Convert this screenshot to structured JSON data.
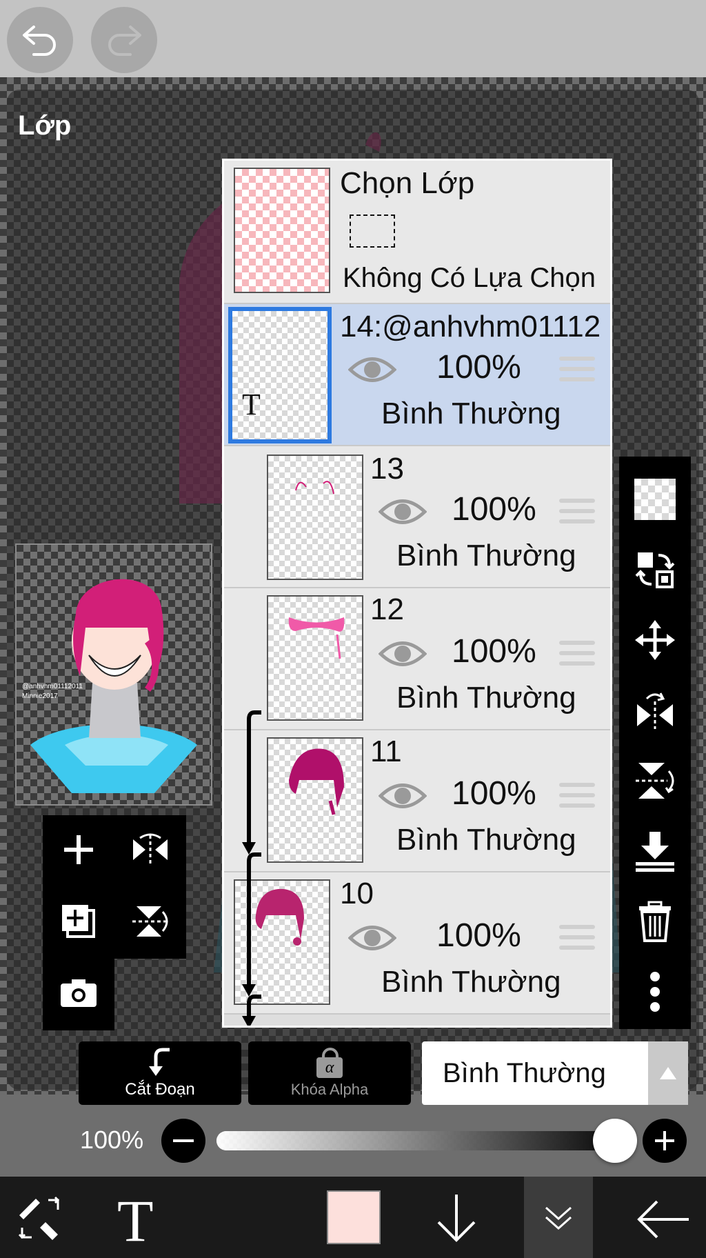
{
  "window": {
    "title": "Lớp"
  },
  "selection": {
    "title": "Chọn Lớp",
    "status": "Không Có Lựa Chọn"
  },
  "layers": [
    {
      "name": "14:@anhvhm01112",
      "opacity": "100%",
      "blend": "Bình Thường",
      "selected": true,
      "text_layer_glyph": "T"
    },
    {
      "name": "13",
      "opacity": "100%",
      "blend": "Bình Thường"
    },
    {
      "name": "12",
      "opacity": "100%",
      "blend": "Bình Thường"
    },
    {
      "name": "11",
      "opacity": "100%",
      "blend": "Bình Thường"
    },
    {
      "name": "10",
      "opacity": "100%",
      "blend": "Bình Thường"
    }
  ],
  "preview": {
    "watermark_line1": "@anhvhm01112011",
    "watermark_line2": "Minnie2017"
  },
  "actions": {
    "clip_label": "Cắt Đoạn",
    "alpha_lock_label": "Khóa Alpha",
    "alpha_glyph": "α"
  },
  "blend_dropdown": {
    "value": "Bình Thường"
  },
  "opacity": {
    "label": "100%",
    "value": 1.0
  },
  "bottom_bar": {
    "text_tool_glyph": "T",
    "color": "#fde0dc"
  },
  "icons": [
    "undo-icon",
    "redo-icon",
    "transparent-checker-icon",
    "layer-swap-icon",
    "move-icon",
    "flip-horizontal-icon",
    "flip-vertical-icon",
    "merge-down-icon",
    "trash-icon",
    "more-vertical-icon",
    "add-layer-icon",
    "mirror-icon",
    "duplicate-layer-icon",
    "rotate-flip-icon",
    "camera-icon",
    "eraser-brush-icon",
    "arrow-down-icon",
    "collapse-icon",
    "back-arrow-icon",
    "eye-icon"
  ],
  "colors": {
    "selected_row": "#c9d7ee",
    "selected_border": "#2e7ae0",
    "hair": "#d21f78",
    "shirt": "#3ec9ef"
  }
}
